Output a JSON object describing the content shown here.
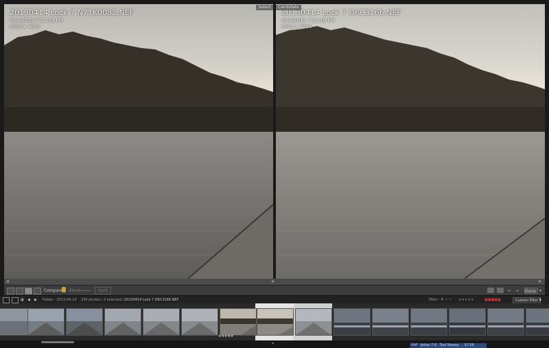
{
  "left_photo": {
    "filename": "20130414 Lock 7 N71K0082.NEF",
    "datetime": "4/14/2013 7:12:53 PM",
    "dimensions": "6000 x 4000",
    "label": "Select"
  },
  "right_photo": {
    "filename": "20130414 Lock 7 D6C3166.NEF",
    "datetime": "4/14/2013 7:14:18 PM",
    "dimensions": "6016 x 4016",
    "label": "Candidate"
  },
  "toolbar": {
    "compare_label": "Compare :",
    "zoom_label": "Zoom",
    "done_label": "Done"
  },
  "filmstrip_bar": {
    "folder_label": "Folder : 2013-04-14",
    "count_label": "236 photos / 2 selected /",
    "selected_file": "20130414 Lock 7 D6C3166.NEF",
    "filter_label": "Filter :",
    "custom_filter": "Custom Filter"
  },
  "status": {
    "badge": "NAP",
    "item1": "Jettar 7.8",
    "item2": "Tool Noway",
    "value": "37.56"
  },
  "icons": {
    "lock": "lock-icon",
    "swap": "swap-icon",
    "close": "close-icon"
  }
}
